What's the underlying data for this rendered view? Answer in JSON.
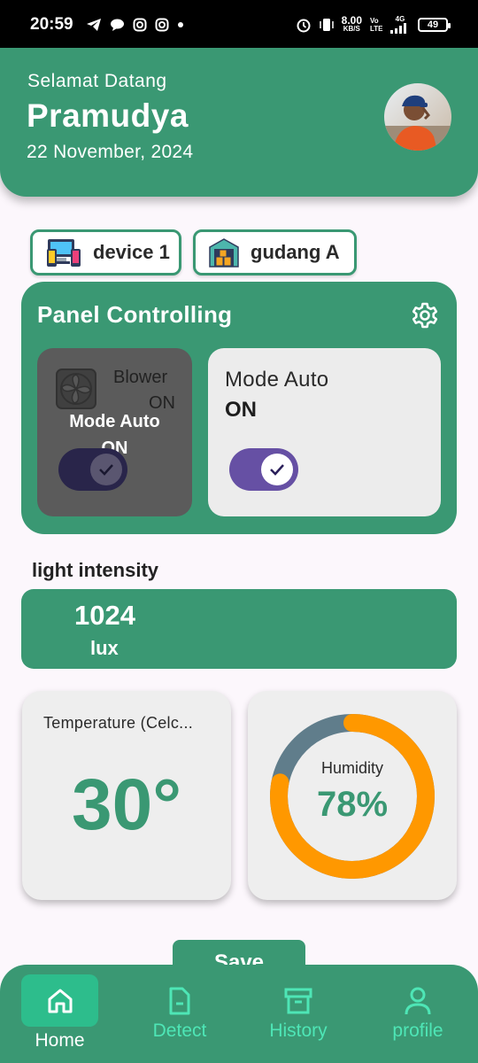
{
  "status_bar": {
    "time": "20:59",
    "net_speed_value": "8.00",
    "net_speed_unit": "KB/S",
    "volte": "Vo LTE",
    "network": "4G",
    "battery": "49"
  },
  "header": {
    "greeting": "Selamat Datang",
    "username": "Pramudya",
    "date": "22 November, 2024"
  },
  "chips": {
    "device": "device 1",
    "location": "gudang A"
  },
  "panel": {
    "title": "Panel Controlling",
    "blower": {
      "label": "Blower",
      "state": "ON",
      "overlay_mode_label": "Mode Auto",
      "overlay_mode_state": "ON",
      "toggle_on": true
    },
    "mode": {
      "label": "Mode Auto",
      "state": "ON",
      "toggle_on": true
    }
  },
  "light": {
    "title": "light intensity",
    "value": "1024",
    "unit": "lux"
  },
  "temperature": {
    "title": "Temperature (Celc...",
    "value": "30°"
  },
  "humidity": {
    "title": "Humidity",
    "value": "78%",
    "percent": 78
  },
  "save_label": "Save",
  "nav": {
    "home": "Home",
    "detect": "Detect",
    "history": "History",
    "profile": "profile"
  },
  "colors": {
    "primary": "#3a9873",
    "accent_orange": "#ff9800",
    "track": "#607d8b",
    "toggle_purple": "#6650a4",
    "nav_text": "#4ee6b6"
  }
}
